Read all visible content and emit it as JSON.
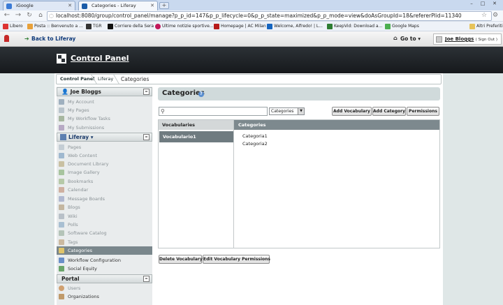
{
  "browser": {
    "tabs": [
      {
        "label": "iGoogle",
        "active": false
      },
      {
        "label": "Categories - Liferay",
        "active": true
      }
    ],
    "new_tab": "+",
    "window_buttons": [
      "–",
      "□",
      "✕"
    ],
    "url": "localhost:8080/group/control_panel/manage?p_p_id=147&p_p_lifecycle=0&p_p_state=maximized&p_p_mode=view&doAsGroupId=18&refererPlid=11340"
  },
  "bookmarks": {
    "items": [
      "Libero",
      "Posta :: Benvenuto a ...",
      "TGR",
      "Corriere della Sera",
      "Ultime notizie sportive...",
      "Homepage | AC Milan",
      "Welcome, Alfredo! | L...",
      "KeepVid: Download a...",
      "Google Maps"
    ],
    "other": "Altri Preferiti"
  },
  "dockbar": {
    "back_label": "Back to Liferay",
    "goto_label": "Go to ▾",
    "user_name": "Joe Bloggs",
    "sign_out": "( Sign Out )"
  },
  "header": {
    "title": "Control Panel"
  },
  "breadcrumb": [
    "Control Panel",
    "Liferay",
    "Categories"
  ],
  "sidebar": {
    "user_panel": {
      "title": "Joe Bloggs",
      "toggle": "–",
      "items": [
        "My Account",
        "My Pages",
        "My Workflow Tasks",
        "My Submissions"
      ]
    },
    "liferay_panel": {
      "title": "Liferay ▾",
      "toggle": "–",
      "items": [
        "Pages",
        "Web Content",
        "Document Library",
        "Image Gallery",
        "Bookmarks",
        "Calendar",
        "Message Boards",
        "Blogs",
        "Wiki",
        "Polls",
        "Software Catalog",
        "Tags",
        "Categories",
        "Workflow Configuration",
        "Social Equity"
      ]
    },
    "portal_panel": {
      "title": "Portal",
      "toggle": "–",
      "items": [
        "Users",
        "Organizations"
      ]
    }
  },
  "content": {
    "title": "Categories",
    "help": "?",
    "search_value": "",
    "select_value": "Categories",
    "buttons": {
      "add_vocabulary": "Add Vocabulary",
      "add_category": "Add Category",
      "permissions": "Permissions"
    },
    "table": {
      "vocabularies_header": "Vocabularies",
      "categories_header": "Categories",
      "vocabularies": [
        "Vocabulario1"
      ],
      "categories": [
        "Categoria1",
        "Categoria2"
      ]
    },
    "bottom_buttons": {
      "delete_vocabulary": "Delete Vocabulary",
      "edit_permissions": "Edit Vocabulary Permissions"
    }
  }
}
